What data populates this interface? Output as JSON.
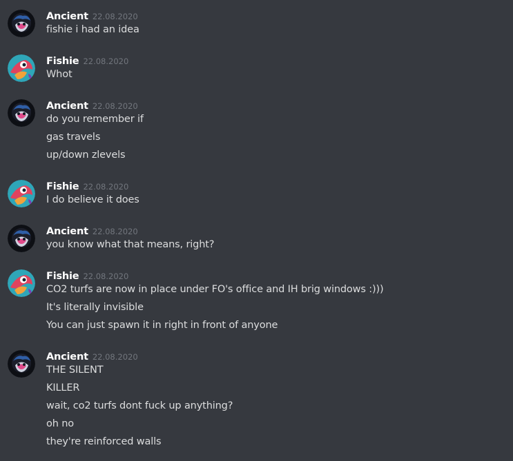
{
  "groups": [
    {
      "author": "Ancient",
      "avatar_icon": "ancient-avatar-icon",
      "time": "22.08.2020",
      "lines": [
        "fishie i had an idea"
      ]
    },
    {
      "author": "Fishie",
      "avatar_icon": "fishie-avatar-icon",
      "time": "22.08.2020",
      "lines": [
        "Whot"
      ]
    },
    {
      "author": "Ancient",
      "avatar_icon": "ancient-avatar-icon",
      "time": "22.08.2020",
      "lines": [
        "do you remember if",
        "gas travels",
        "up/down zlevels"
      ]
    },
    {
      "author": "Fishie",
      "avatar_icon": "fishie-avatar-icon",
      "time": "22.08.2020",
      "lines": [
        "I do believe it does"
      ]
    },
    {
      "author": "Ancient",
      "avatar_icon": "ancient-avatar-icon",
      "time": "22.08.2020",
      "lines": [
        "you know what that means, right?"
      ]
    },
    {
      "author": "Fishie",
      "avatar_icon": "fishie-avatar-icon",
      "time": "22.08.2020",
      "lines": [
        "CO2 turfs are now in place under FO's office and IH brig windows :)))",
        "It's literally invisible",
        "You can just spawn it in right in front of anyone"
      ]
    },
    {
      "author": "Ancient",
      "avatar_icon": "ancient-avatar-icon",
      "time": "22.08.2020",
      "lines": [
        "THE SILENT",
        "KILLER",
        "wait, co2 turfs dont fuck up anything?",
        "oh no",
        "they're reinforced walls"
      ]
    }
  ]
}
